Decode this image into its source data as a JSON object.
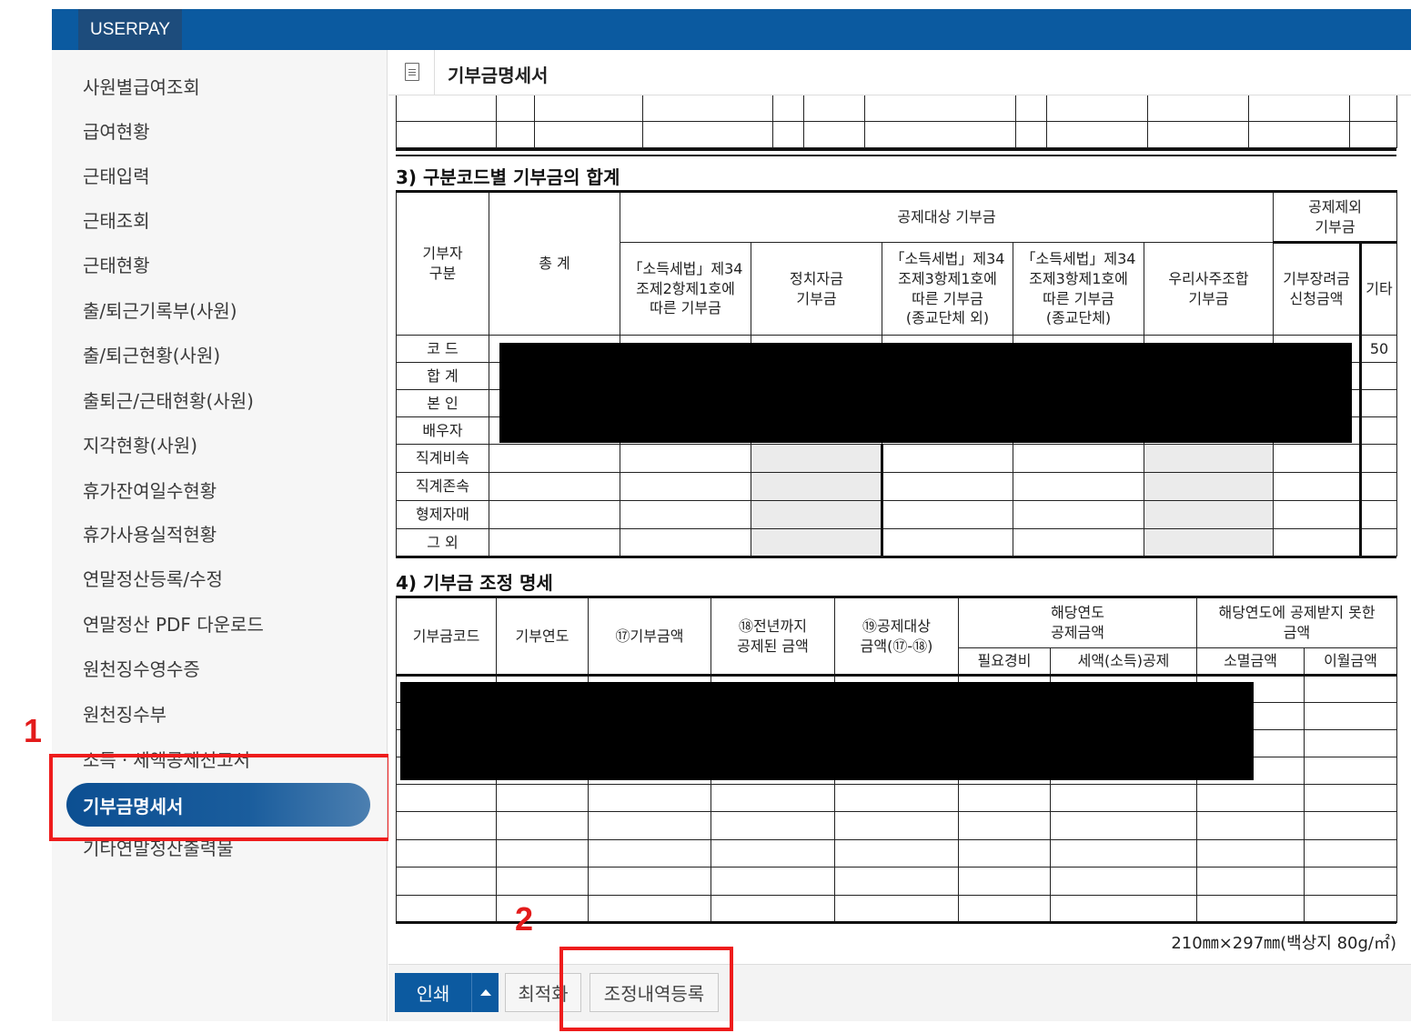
{
  "app": {
    "brand": "USERPAY"
  },
  "sidebar": {
    "items": [
      {
        "label": "사원별급여조회"
      },
      {
        "label": "급여현황"
      },
      {
        "label": "근태입력"
      },
      {
        "label": "근태조회"
      },
      {
        "label": "근태현황"
      },
      {
        "label": "출/퇴근기록부(사원)"
      },
      {
        "label": "출/퇴근현황(사원)"
      },
      {
        "label": "출퇴근/근태현황(사원)"
      },
      {
        "label": "지각현황(사원)"
      },
      {
        "label": "휴가잔여일수현황"
      },
      {
        "label": "휴가사용실적현황"
      },
      {
        "label": "연말정산등록/수정"
      },
      {
        "label": "연말정산 PDF 다운로드"
      },
      {
        "label": "원천징수영수증"
      },
      {
        "label": "원천징수부"
      },
      {
        "label": "소득ㆍ세액공제신고서"
      },
      {
        "label": "기부금명세서",
        "active": true
      },
      {
        "label": "기타연말정산출력물"
      }
    ]
  },
  "annotations": {
    "marker1": "1",
    "marker2": "2"
  },
  "main": {
    "title": "기부금명세서",
    "section3": {
      "title": "3) 구분코드별 기부금의 합계",
      "h_donor": "기부자\n구분",
      "h_total": "총 계",
      "h_deductible": "공제대상 기부금",
      "h_excluded": "공제제외\n기부금",
      "h_cols": [
        "「소득세법」제34\n조제2항제1호에\n따른 기부금",
        "정치자금\n기부금",
        "「소득세법」제34\n조제3항제1호에\n따른 기부금\n(종교단체 외)",
        "「소득세법」제34\n조제3항제1호에\n따른 기부금\n(종교단체)",
        "우리사주조합\n기부금",
        "기부장려금\n신청금액",
        "기타"
      ],
      "rows": [
        "코 드",
        "합 계",
        "본 인",
        "배우자",
        "직계비속",
        "직계존속",
        "형제자매",
        "그 외"
      ],
      "code_last": "50"
    },
    "section4": {
      "title": "4) 기부금 조정 명세",
      "h_code": "기부금코드",
      "h_year": "기부연도",
      "h_amount": "⑰기부금액",
      "h_prev": "⑱전년까지\n공제된 금액",
      "h_target": "⑲공제대상\n금액(⑰-⑱)",
      "h_current": "해당연도\n공제금액",
      "h_expense": "필요경비",
      "h_tax": "세액(소득)공제",
      "h_notdeducted": "해당연도에 공제받지 못한\n금액",
      "h_extinct": "소멸금액",
      "h_carry": "이월금액"
    },
    "paper_note": "210㎜×297㎜(백상지 80g/㎡)"
  },
  "toolbar": {
    "print_label": "인쇄",
    "optimize_label": "최적화",
    "adjust_label": "조정내역등록"
  }
}
